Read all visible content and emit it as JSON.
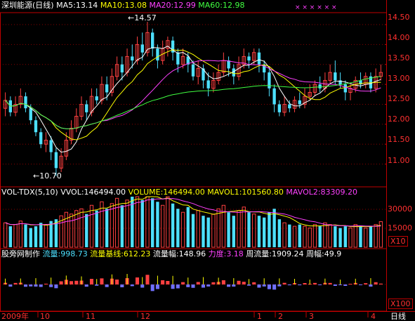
{
  "colors": {
    "background": "#000000",
    "grid": "#8a0000",
    "frame": "#c00000",
    "up": "#ff4040",
    "down": "#4de0ff",
    "ma5": "#ffffff",
    "ma10": "#ffff00",
    "ma20": "#ff40ff",
    "ma60": "#40ff40",
    "axis_text": "#ff3030",
    "vol_ma1": "#ffff00",
    "vol_ma2": "#ff40ff",
    "flow_up": "#ff4040",
    "flow_down": "#7070ff",
    "flow_line": "#ffff00"
  },
  "price_panel": {
    "title": "深圳能源(日线)",
    "indicators": [
      {
        "label": "MA5:13.14",
        "color": "#ffffff"
      },
      {
        "label": "MA10:13.08",
        "color": "#ffff00"
      },
      {
        "label": "MA20:12.99",
        "color": "#ff40ff"
      },
      {
        "label": "MA60:12.98",
        "color": "#40ff40"
      }
    ],
    "y_ticks": [
      "14.50",
      "14.00",
      "13.50",
      "13.00",
      "12.50",
      "12.00",
      "11.50",
      "11.00"
    ],
    "high_annotation": "14.57",
    "low_annotation": "10.70",
    "markers": "× × × × × ×"
  },
  "volume_panel": {
    "indicators": [
      {
        "label": "VOL-TDX(5,10)",
        "color": "#ffffff"
      },
      {
        "label": "VVOL:146494.00",
        "color": "#ffffff"
      },
      {
        "label": "VOLUME:146494.00",
        "color": "#ffff00"
      },
      {
        "label": "MAVOL1:101560.80",
        "color": "#ffff00"
      },
      {
        "label": "MAVOL2:83309.20",
        "color": "#ff40ff"
      }
    ],
    "y_ticks": [
      "30000",
      "15000"
    ],
    "multiplier": "X10"
  },
  "flow_panel": {
    "indicators": [
      {
        "label": "股旁网制作",
        "color": "#ffffff"
      },
      {
        "label": "流量:998.73",
        "color": "#4de0ff"
      },
      {
        "label": "流量基线:612.23",
        "color": "#ffff00"
      },
      {
        "label": "流量幅:148.96",
        "color": "#ffffff"
      },
      {
        "label": "力度:3.18",
        "color": "#ff40ff"
      },
      {
        "label": "周流量:1909.24",
        "color": "#ffffff"
      },
      {
        "label": "周幅:49.9",
        "color": "#ffffff"
      }
    ],
    "multiplier": "X100"
  },
  "x_axis": {
    "labels": [
      {
        "text": "2009年",
        "color": "#ff3030"
      },
      {
        "text": "10",
        "color": "#ff3030"
      },
      {
        "text": "11",
        "color": "#ff3030"
      },
      {
        "text": "12",
        "color": "#ff3030"
      },
      {
        "text": "1",
        "color": "#ff3030"
      },
      {
        "text": "2",
        "color": "#ff3030"
      },
      {
        "text": "3",
        "color": "#ff3030"
      },
      {
        "text": "4",
        "color": "#ff3030"
      }
    ],
    "period_label": "日线"
  },
  "chart_data": {
    "type": "candlestick",
    "y_range": [
      10.5,
      14.8
    ],
    "candles": [
      [
        12.4,
        12.6,
        12.8,
        12.2
      ],
      [
        12.6,
        12.3,
        12.7,
        12.2
      ],
      [
        12.3,
        12.5,
        12.7,
        12.2
      ],
      [
        12.5,
        12.7,
        12.9,
        12.4
      ],
      [
        12.7,
        12.4,
        12.8,
        12.3
      ],
      [
        12.4,
        12.1,
        12.5,
        12.0
      ],
      [
        12.1,
        11.8,
        12.2,
        11.7
      ],
      [
        11.8,
        11.5,
        11.9,
        11.4
      ],
      [
        11.5,
        11.6,
        11.8,
        11.3
      ],
      [
        11.6,
        11.3,
        11.7,
        11.1
      ],
      [
        11.3,
        10.9,
        11.4,
        10.7
      ],
      [
        10.9,
        11.2,
        11.4,
        10.8
      ],
      [
        11.2,
        11.6,
        11.8,
        11.1
      ],
      [
        11.6,
        11.9,
        12.1,
        11.5
      ],
      [
        11.9,
        12.2,
        12.4,
        11.8
      ],
      [
        12.2,
        12.5,
        12.7,
        12.1
      ],
      [
        12.5,
        12.3,
        12.6,
        12.1
      ],
      [
        12.3,
        12.7,
        12.9,
        12.2
      ],
      [
        12.7,
        12.6,
        12.9,
        12.5
      ],
      [
        12.6,
        13.0,
        13.2,
        12.5
      ],
      [
        13.0,
        12.8,
        13.2,
        12.6
      ],
      [
        12.8,
        13.2,
        13.4,
        12.7
      ],
      [
        13.2,
        13.5,
        13.7,
        13.1
      ],
      [
        13.5,
        13.3,
        13.7,
        13.1
      ],
      [
        13.3,
        13.7,
        13.9,
        13.2
      ],
      [
        13.7,
        13.6,
        14.0,
        13.4
      ],
      [
        13.6,
        14.0,
        14.2,
        13.5
      ],
      [
        14.0,
        13.8,
        14.3,
        13.6
      ],
      [
        13.8,
        14.3,
        14.57,
        13.7
      ],
      [
        14.3,
        13.9,
        14.4,
        13.7
      ],
      [
        13.9,
        13.6,
        14.0,
        13.4
      ],
      [
        13.6,
        13.9,
        14.1,
        13.5
      ],
      [
        13.9,
        14.1,
        14.2,
        13.7
      ],
      [
        14.1,
        13.8,
        14.2,
        13.6
      ],
      [
        13.8,
        13.5,
        13.9,
        13.3
      ],
      [
        13.5,
        13.7,
        13.9,
        13.4
      ],
      [
        13.7,
        13.5,
        13.8,
        13.3
      ],
      [
        13.5,
        13.2,
        13.6,
        13.1
      ],
      [
        13.2,
        13.4,
        13.6,
        13.0
      ],
      [
        13.4,
        13.1,
        13.5,
        12.9
      ],
      [
        13.1,
        12.9,
        13.3,
        12.7
      ],
      [
        12.9,
        13.1,
        13.3,
        12.8
      ],
      [
        13.1,
        13.3,
        13.5,
        13.0
      ],
      [
        13.3,
        13.6,
        13.8,
        13.2
      ],
      [
        13.6,
        13.4,
        13.7,
        13.2
      ],
      [
        13.4,
        13.2,
        13.5,
        13.0
      ],
      [
        13.2,
        13.5,
        13.7,
        13.1
      ],
      [
        13.5,
        13.7,
        13.9,
        13.4
      ],
      [
        13.7,
        13.6,
        13.8,
        13.4
      ],
      [
        13.6,
        13.8,
        13.9,
        13.5
      ],
      [
        13.8,
        13.5,
        13.9,
        13.3
      ],
      [
        13.5,
        13.3,
        13.6,
        13.1
      ],
      [
        13.3,
        12.9,
        13.4,
        12.7
      ],
      [
        12.9,
        12.5,
        13.0,
        12.3
      ],
      [
        12.5,
        12.3,
        12.6,
        12.2
      ],
      [
        12.3,
        12.5,
        12.7,
        12.2
      ],
      [
        12.5,
        12.4,
        12.6,
        12.3
      ],
      [
        12.4,
        12.6,
        12.7,
        12.3
      ],
      [
        12.6,
        12.5,
        12.8,
        12.4
      ],
      [
        12.5,
        12.7,
        12.9,
        12.4
      ],
      [
        12.7,
        12.8,
        13.0,
        12.6
      ],
      [
        12.8,
        13.0,
        13.1,
        12.7
      ],
      [
        13.0,
        12.9,
        13.2,
        12.8
      ],
      [
        12.9,
        13.1,
        13.3,
        12.8
      ],
      [
        13.1,
        13.3,
        13.5,
        13.0
      ],
      [
        13.3,
        13.1,
        13.6,
        13.0
      ],
      [
        13.1,
        13.0,
        13.3,
        12.9
      ],
      [
        13.0,
        12.8,
        13.1,
        12.6
      ],
      [
        12.8,
        12.9,
        13.0,
        12.6
      ],
      [
        12.9,
        13.1,
        13.2,
        12.8
      ],
      [
        13.1,
        13.0,
        13.3,
        12.9
      ],
      [
        13.0,
        13.2,
        13.3,
        12.9
      ],
      [
        13.2,
        12.9,
        13.3,
        12.8
      ],
      [
        12.9,
        13.2,
        13.4,
        12.8
      ],
      [
        13.2,
        13.3,
        13.5,
        13.1
      ]
    ],
    "volume_scale": [
      0,
      45000
    ],
    "volumes": [
      14000,
      12000,
      13000,
      15000,
      13000,
      11000,
      12000,
      14000,
      13000,
      15000,
      16000,
      18000,
      20000,
      19000,
      21000,
      22000,
      19000,
      24000,
      21000,
      26000,
      22000,
      25000,
      28000,
      24000,
      27000,
      29000,
      30000,
      27000,
      33000,
      28000,
      26000,
      24000,
      30000,
      25000,
      22000,
      20000,
      23000,
      19000,
      21000,
      18000,
      17000,
      19000,
      22000,
      24000,
      20000,
      18000,
      21000,
      23000,
      20000,
      19000,
      18000,
      17000,
      20000,
      22000,
      16000,
      14000,
      13000,
      12000,
      13000,
      12000,
      11000,
      13000,
      12000,
      14000,
      13000,
      12000,
      11000,
      12000,
      11000,
      13000,
      12000,
      11000,
      12000,
      13000,
      14650
    ]
  }
}
